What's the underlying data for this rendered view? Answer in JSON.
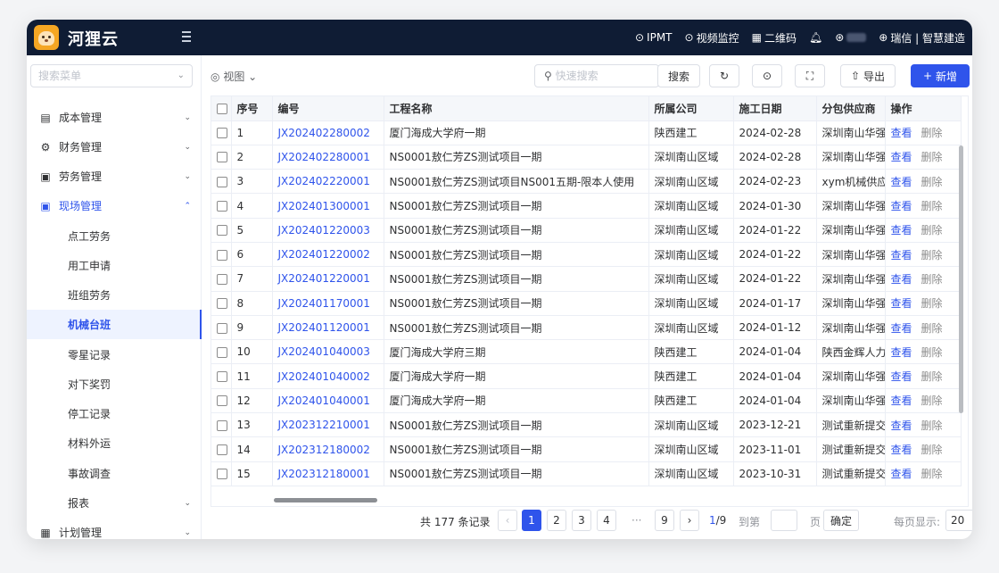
{
  "topbar": {
    "brand": "河狸云",
    "links": [
      {
        "icon": "monitor-icon",
        "label": "IPMT"
      },
      {
        "icon": "video-monitor-icon",
        "label": "视频监控"
      },
      {
        "icon": "qrcode-icon",
        "label": "二维码"
      }
    ],
    "user_icon": "user-icon",
    "org_label": "瑞信 | 智慧建造"
  },
  "sidebar": {
    "search_placeholder": "搜索菜单",
    "items": [
      {
        "label": "成本管理",
        "icon": "cost-icon",
        "arrow": "⌄"
      },
      {
        "label": "财务管理",
        "icon": "finance-icon",
        "arrow": "⌄"
      },
      {
        "label": "劳务管理",
        "icon": "labor-icon",
        "arrow": "⌄"
      },
      {
        "label": "现场管理",
        "icon": "site-icon",
        "arrow": "⌃"
      }
    ],
    "sub_items": [
      "点工劳务",
      "用工申请",
      "班组劳务",
      "机械台班",
      "零星记录",
      "对下奖罚",
      "停工记录",
      "材料外运",
      "事故调查",
      "报表"
    ],
    "active_sub": "机械台班",
    "last_item": {
      "label": "计划管理",
      "icon": "plan-icon"
    }
  },
  "toolbar": {
    "view_label": "视图",
    "quick_search_placeholder": "快速搜索",
    "search_button": "搜索",
    "export_button": "导出",
    "add_button": "新增"
  },
  "table": {
    "headers": [
      "序号",
      "编号",
      "工程名称",
      "所属公司",
      "施工日期",
      "分包供应商",
      "操作"
    ],
    "rows": [
      [
        "1",
        "JX202402280002",
        "厦门海成大学府一期",
        "陕西建工",
        "2024-02-28",
        "深圳南山华强i"
      ],
      [
        "2",
        "JX202402280001",
        "NS0001敖仁芳ZS测试项目一期",
        "深圳南山区域",
        "2024-02-28",
        "深圳南山华强i"
      ],
      [
        "3",
        "JX202402220001",
        "NS0001敖仁芳ZS测试项目NS001五期-限本人使用",
        "深圳南山区域",
        "2024-02-23",
        "xym机械供应商"
      ],
      [
        "4",
        "JX202401300001",
        "NS0001敖仁芳ZS测试项目一期",
        "深圳南山区域",
        "2024-01-30",
        "深圳南山华强i"
      ],
      [
        "5",
        "JX202401220003",
        "NS0001敖仁芳ZS测试项目一期",
        "深圳南山区域",
        "2024-01-22",
        "深圳南山华强i"
      ],
      [
        "6",
        "JX202401220002",
        "NS0001敖仁芳ZS测试项目一期",
        "深圳南山区域",
        "2024-01-22",
        "深圳南山华强i"
      ],
      [
        "7",
        "JX202401220001",
        "NS0001敖仁芳ZS测试项目一期",
        "深圳南山区域",
        "2024-01-22",
        "深圳南山华强i"
      ],
      [
        "8",
        "JX202401170001",
        "NS0001敖仁芳ZS测试项目一期",
        "深圳南山区域",
        "2024-01-17",
        "深圳南山华强i"
      ],
      [
        "9",
        "JX202401120001",
        "NS0001敖仁芳ZS测试项目一期",
        "深圳南山区域",
        "2024-01-12",
        "深圳南山华强i"
      ],
      [
        "10",
        "JX202401040003",
        "厦门海成大学府三期",
        "陕西建工",
        "2024-01-04",
        "陕西金辉人力i"
      ],
      [
        "11",
        "JX202401040002",
        "厦门海成大学府一期",
        "陕西建工",
        "2024-01-04",
        "深圳南山华强i"
      ],
      [
        "12",
        "JX202401040001",
        "厦门海成大学府一期",
        "陕西建工",
        "2024-01-04",
        "深圳南山华强i"
      ],
      [
        "13",
        "JX202312210001",
        "NS0001敖仁芳ZS测试项目一期",
        "深圳南山区域",
        "2023-12-21",
        "测试重新提交"
      ],
      [
        "14",
        "JX202312180002",
        "NS0001敖仁芳ZS测试项目一期",
        "深圳南山区域",
        "2023-11-01",
        "测试重新提交"
      ],
      [
        "15",
        "JX202312180001",
        "NS0001敖仁芳ZS测试项目一期",
        "深圳南山区域",
        "2023-10-31",
        "测试重新提交"
      ]
    ],
    "op_view": "查看",
    "op_delete": "删除"
  },
  "pagination": {
    "total": "共 177 条记录",
    "pages": [
      "1",
      "2",
      "3",
      "4"
    ],
    "ellipsis": "···",
    "last_page": "9",
    "current": "1",
    "page_info": "/9",
    "goto_label": "到第",
    "page_unit": "页",
    "confirm": "确定",
    "per_page_label": "每页显示:",
    "per_page": "20"
  },
  "colors": {
    "topbar_bg": "#0f1c34",
    "accent": "#2f54eb"
  }
}
